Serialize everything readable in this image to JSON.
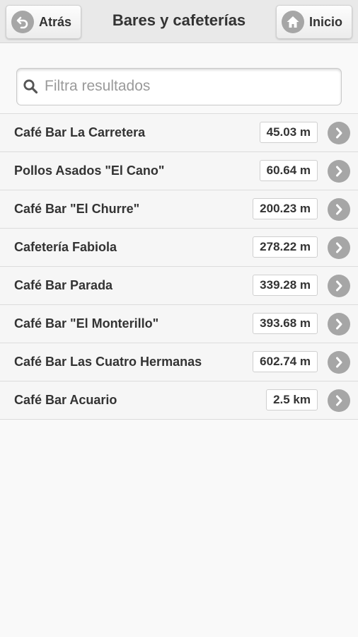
{
  "header": {
    "back_label": "Atrás",
    "title": "Bares y cafeterías",
    "home_label": "Inicio"
  },
  "search": {
    "placeholder": "Filtra resultados",
    "value": ""
  },
  "results": [
    {
      "name": "Café Bar La Carretera",
      "distance": "45.03 m"
    },
    {
      "name": "Pollos Asados \"El Cano\"",
      "distance": "60.64 m"
    },
    {
      "name": "Café Bar \"El Churre\"",
      "distance": "200.23 m"
    },
    {
      "name": "Cafetería Fabiola",
      "distance": "278.22 m"
    },
    {
      "name": "Café Bar Parada",
      "distance": "339.28 m"
    },
    {
      "name": "Café Bar \"El Monterillo\"",
      "distance": "393.68 m"
    },
    {
      "name": "Café Bar Las Cuatro Hermanas",
      "distance": "602.74 m"
    },
    {
      "name": "Café Bar Acuario",
      "distance": "2.5 km"
    }
  ],
  "icons": {
    "back": "back-arrow-icon",
    "home": "home-icon",
    "search": "search-icon",
    "row": "chevron-right-icon"
  },
  "colors": {
    "header_bg": "#e9e9e9",
    "icon_circle": "#a6a6a6",
    "text": "#333333"
  }
}
